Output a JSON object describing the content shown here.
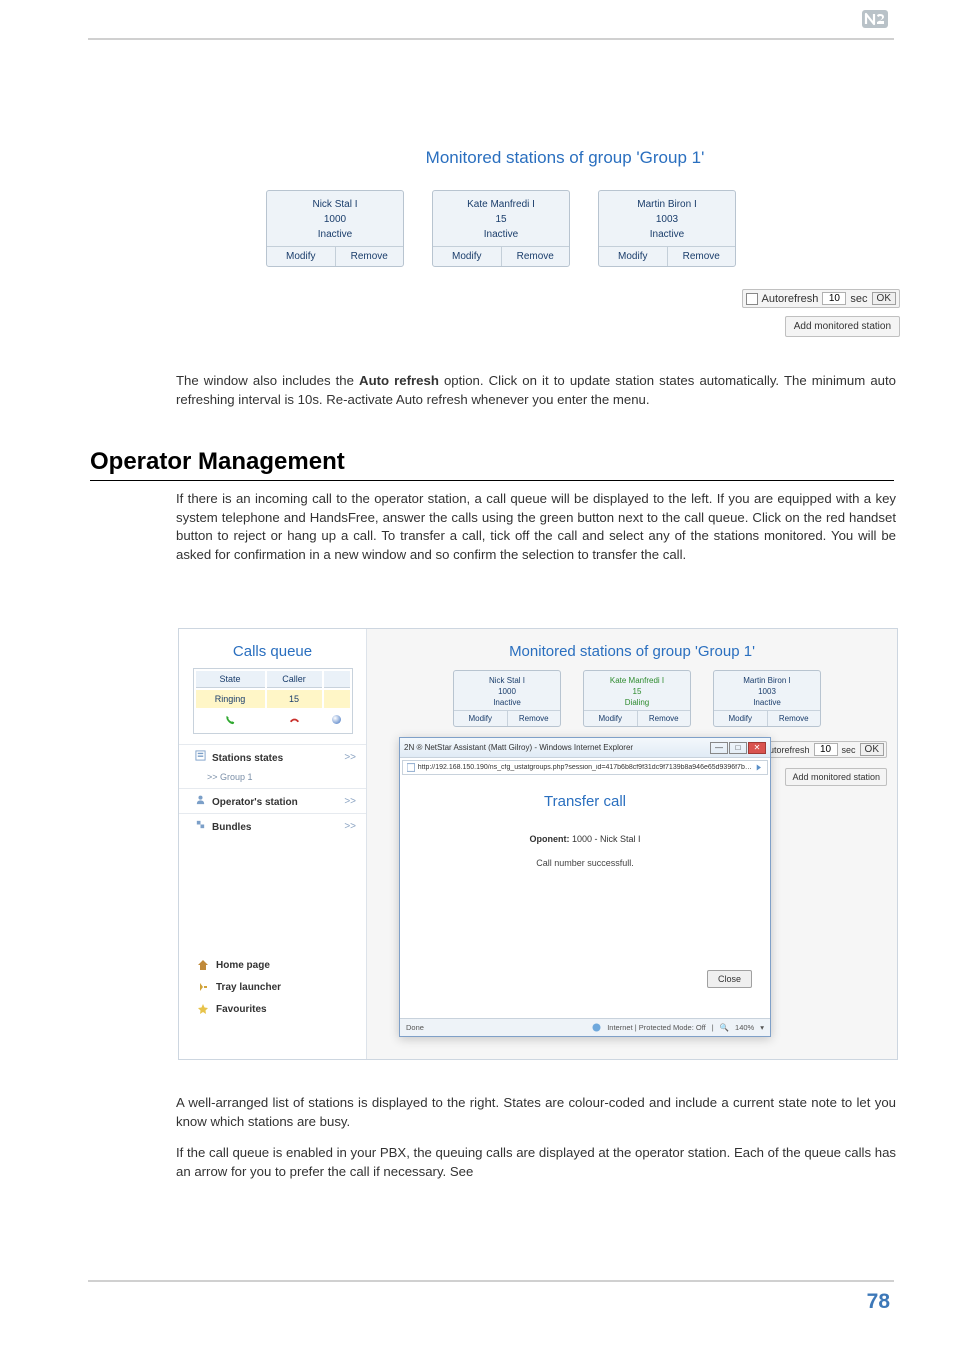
{
  "logo_alt": "2N",
  "section1": {
    "title": "Monitored stations of group 'Group 1'",
    "stations": [
      {
        "name": "Nick Stal I",
        "num": "1000",
        "state": "Inactive",
        "modify": "Modify",
        "remove": "Remove"
      },
      {
        "name": "Kate Manfredi I",
        "num": "15",
        "state": "Inactive",
        "modify": "Modify",
        "remove": "Remove"
      },
      {
        "name": "Martin Biron I",
        "num": "1003",
        "state": "Inactive",
        "modify": "Modify",
        "remove": "Remove"
      }
    ],
    "autorefresh": {
      "checked": false,
      "label": "Autorefresh",
      "value": "10",
      "unit": "sec",
      "ok": "OK"
    },
    "add_monitored": "Add monitored station"
  },
  "para1_pre": "The window also includes the ",
  "para1_bold": "Auto refresh",
  "para1_post": " option. Click on it to update station states automatically. The minimum auto refreshing interval is 10s. Re-activate Auto refresh whenever you enter the menu.",
  "h2": "Operator Management",
  "para2": "If there is an incoming call to the operator station, a call queue will be displayed to the left. If you are equipped with a key system telephone and HandsFree, answer the calls using the green button next to the call queue. Click on the red handset button to reject or hang up a call. To transfer a call, tick off the call and select any of the stations monitored. You will be asked for confirmation in a new window and so confirm the selection to transfer the call.",
  "section2": {
    "calls_queue": "Calls queue",
    "th_state": "State",
    "th_caller": "Caller",
    "row_state": "Ringing",
    "row_caller": "15",
    "sidebar": {
      "stations_states": "Stations states",
      "group1": "Group 1",
      "operators_station": "Operator's station",
      "bundles": "Bundles",
      "home": "Home page",
      "tray": "Tray launcher",
      "fav": "Favourites"
    },
    "title": "Monitored stations of group 'Group 1'",
    "stations": [
      {
        "name": "Nick Stal I",
        "num": "1000",
        "state": "Inactive",
        "modify": "Modify",
        "remove": "Remove"
      },
      {
        "name": "Kate Manfredi I",
        "num": "15",
        "state": "Dialing",
        "on": true,
        "modify": "Modify",
        "remove": "Remove"
      },
      {
        "name": "Martin Biron I",
        "num": "1003",
        "state": "Inactive",
        "modify": "Modify",
        "remove": "Remove"
      }
    ],
    "autorefresh": {
      "checked": true,
      "label": "Autorefresh",
      "value": "10",
      "unit": "sec",
      "ok": "OK"
    },
    "add_monitored": "Add monitored station",
    "popup": {
      "window_title": "2N ® NetStar Assistant (Matt Gilroy) - Windows Internet Explorer",
      "url": "http://192.168.150.190/ns_cfg_ustatgroups.php?session_id=417b6b8cf9f31dc9f7139b8a946e65d9396f7bbe8cmainapp=opera",
      "title": "Transfer call",
      "oponent_label": "Oponent:",
      "oponent_value": "1000 - Nick Stal I",
      "status_line": "Call number successfull.",
      "close": "Close",
      "done": "Done",
      "internet": "Internet | Protected Mode: Off",
      "zoom": "140%"
    }
  },
  "para3": "A well-arranged list of stations is displayed to the right. States are colour-coded and include a current state note to let you know which stations are busy.",
  "para4": "If the call queue is enabled in your PBX, the queuing calls are displayed at the operator station. Each of the queue calls has an arrow for you to prefer the call if necessary. See",
  "pagenum": "78"
}
